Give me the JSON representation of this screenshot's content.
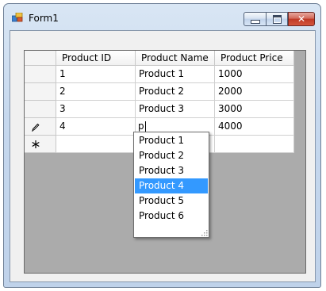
{
  "window": {
    "title": "Form1",
    "controls": {
      "minimize": "minimize",
      "maximize": "maximize",
      "close": "✕"
    }
  },
  "grid": {
    "columns": [
      "Product ID",
      "Product Name",
      "Product Price"
    ],
    "rows": [
      {
        "id": "1",
        "name": "Product 1",
        "price": "1000"
      },
      {
        "id": "2",
        "name": "Product 2",
        "price": "2000"
      },
      {
        "id": "3",
        "name": "Product 3",
        "price": "3000"
      },
      {
        "id": "4",
        "name": "p",
        "price": "4000",
        "editing": true
      }
    ],
    "row_header_icons": {
      "editing": "pencil-icon",
      "new_row": "asterisk-icon"
    }
  },
  "dropdown": {
    "options": [
      "Product 1",
      "Product 2",
      "Product 3",
      "Product 4",
      "Product 5",
      "Product 6"
    ],
    "highlighted": "Product 4"
  },
  "colors": {
    "selection": "#3399ff",
    "grid_background": "#ababab",
    "close_button": "#c84a36"
  }
}
